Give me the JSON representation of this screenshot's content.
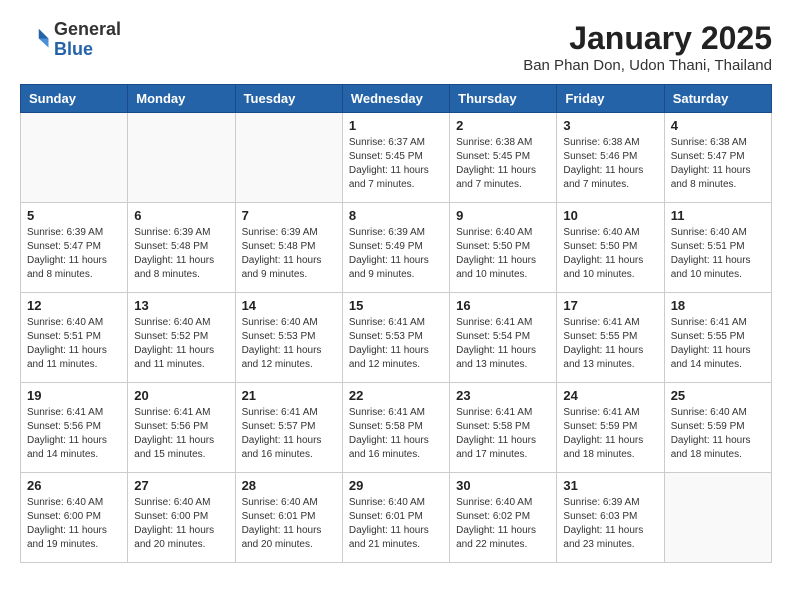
{
  "logo": {
    "general": "General",
    "blue": "Blue"
  },
  "title": "January 2025",
  "subtitle": "Ban Phan Don, Udon Thani, Thailand",
  "weekdays": [
    "Sunday",
    "Monday",
    "Tuesday",
    "Wednesday",
    "Thursday",
    "Friday",
    "Saturday"
  ],
  "weeks": [
    [
      {
        "day": "",
        "sunrise": "",
        "sunset": "",
        "daylight": ""
      },
      {
        "day": "",
        "sunrise": "",
        "sunset": "",
        "daylight": ""
      },
      {
        "day": "",
        "sunrise": "",
        "sunset": "",
        "daylight": ""
      },
      {
        "day": "1",
        "sunrise": "Sunrise: 6:37 AM",
        "sunset": "Sunset: 5:45 PM",
        "daylight": "Daylight: 11 hours and 7 minutes."
      },
      {
        "day": "2",
        "sunrise": "Sunrise: 6:38 AM",
        "sunset": "Sunset: 5:45 PM",
        "daylight": "Daylight: 11 hours and 7 minutes."
      },
      {
        "day": "3",
        "sunrise": "Sunrise: 6:38 AM",
        "sunset": "Sunset: 5:46 PM",
        "daylight": "Daylight: 11 hours and 7 minutes."
      },
      {
        "day": "4",
        "sunrise": "Sunrise: 6:38 AM",
        "sunset": "Sunset: 5:47 PM",
        "daylight": "Daylight: 11 hours and 8 minutes."
      }
    ],
    [
      {
        "day": "5",
        "sunrise": "Sunrise: 6:39 AM",
        "sunset": "Sunset: 5:47 PM",
        "daylight": "Daylight: 11 hours and 8 minutes."
      },
      {
        "day": "6",
        "sunrise": "Sunrise: 6:39 AM",
        "sunset": "Sunset: 5:48 PM",
        "daylight": "Daylight: 11 hours and 8 minutes."
      },
      {
        "day": "7",
        "sunrise": "Sunrise: 6:39 AM",
        "sunset": "Sunset: 5:48 PM",
        "daylight": "Daylight: 11 hours and 9 minutes."
      },
      {
        "day": "8",
        "sunrise": "Sunrise: 6:39 AM",
        "sunset": "Sunset: 5:49 PM",
        "daylight": "Daylight: 11 hours and 9 minutes."
      },
      {
        "day": "9",
        "sunrise": "Sunrise: 6:40 AM",
        "sunset": "Sunset: 5:50 PM",
        "daylight": "Daylight: 11 hours and 10 minutes."
      },
      {
        "day": "10",
        "sunrise": "Sunrise: 6:40 AM",
        "sunset": "Sunset: 5:50 PM",
        "daylight": "Daylight: 11 hours and 10 minutes."
      },
      {
        "day": "11",
        "sunrise": "Sunrise: 6:40 AM",
        "sunset": "Sunset: 5:51 PM",
        "daylight": "Daylight: 11 hours and 10 minutes."
      }
    ],
    [
      {
        "day": "12",
        "sunrise": "Sunrise: 6:40 AM",
        "sunset": "Sunset: 5:51 PM",
        "daylight": "Daylight: 11 hours and 11 minutes."
      },
      {
        "day": "13",
        "sunrise": "Sunrise: 6:40 AM",
        "sunset": "Sunset: 5:52 PM",
        "daylight": "Daylight: 11 hours and 11 minutes."
      },
      {
        "day": "14",
        "sunrise": "Sunrise: 6:40 AM",
        "sunset": "Sunset: 5:53 PM",
        "daylight": "Daylight: 11 hours and 12 minutes."
      },
      {
        "day": "15",
        "sunrise": "Sunrise: 6:41 AM",
        "sunset": "Sunset: 5:53 PM",
        "daylight": "Daylight: 11 hours and 12 minutes."
      },
      {
        "day": "16",
        "sunrise": "Sunrise: 6:41 AM",
        "sunset": "Sunset: 5:54 PM",
        "daylight": "Daylight: 11 hours and 13 minutes."
      },
      {
        "day": "17",
        "sunrise": "Sunrise: 6:41 AM",
        "sunset": "Sunset: 5:55 PM",
        "daylight": "Daylight: 11 hours and 13 minutes."
      },
      {
        "day": "18",
        "sunrise": "Sunrise: 6:41 AM",
        "sunset": "Sunset: 5:55 PM",
        "daylight": "Daylight: 11 hours and 14 minutes."
      }
    ],
    [
      {
        "day": "19",
        "sunrise": "Sunrise: 6:41 AM",
        "sunset": "Sunset: 5:56 PM",
        "daylight": "Daylight: 11 hours and 14 minutes."
      },
      {
        "day": "20",
        "sunrise": "Sunrise: 6:41 AM",
        "sunset": "Sunset: 5:56 PM",
        "daylight": "Daylight: 11 hours and 15 minutes."
      },
      {
        "day": "21",
        "sunrise": "Sunrise: 6:41 AM",
        "sunset": "Sunset: 5:57 PM",
        "daylight": "Daylight: 11 hours and 16 minutes."
      },
      {
        "day": "22",
        "sunrise": "Sunrise: 6:41 AM",
        "sunset": "Sunset: 5:58 PM",
        "daylight": "Daylight: 11 hours and 16 minutes."
      },
      {
        "day": "23",
        "sunrise": "Sunrise: 6:41 AM",
        "sunset": "Sunset: 5:58 PM",
        "daylight": "Daylight: 11 hours and 17 minutes."
      },
      {
        "day": "24",
        "sunrise": "Sunrise: 6:41 AM",
        "sunset": "Sunset: 5:59 PM",
        "daylight": "Daylight: 11 hours and 18 minutes."
      },
      {
        "day": "25",
        "sunrise": "Sunrise: 6:40 AM",
        "sunset": "Sunset: 5:59 PM",
        "daylight": "Daylight: 11 hours and 18 minutes."
      }
    ],
    [
      {
        "day": "26",
        "sunrise": "Sunrise: 6:40 AM",
        "sunset": "Sunset: 6:00 PM",
        "daylight": "Daylight: 11 hours and 19 minutes."
      },
      {
        "day": "27",
        "sunrise": "Sunrise: 6:40 AM",
        "sunset": "Sunset: 6:00 PM",
        "daylight": "Daylight: 11 hours and 20 minutes."
      },
      {
        "day": "28",
        "sunrise": "Sunrise: 6:40 AM",
        "sunset": "Sunset: 6:01 PM",
        "daylight": "Daylight: 11 hours and 20 minutes."
      },
      {
        "day": "29",
        "sunrise": "Sunrise: 6:40 AM",
        "sunset": "Sunset: 6:01 PM",
        "daylight": "Daylight: 11 hours and 21 minutes."
      },
      {
        "day": "30",
        "sunrise": "Sunrise: 6:40 AM",
        "sunset": "Sunset: 6:02 PM",
        "daylight": "Daylight: 11 hours and 22 minutes."
      },
      {
        "day": "31",
        "sunrise": "Sunrise: 6:39 AM",
        "sunset": "Sunset: 6:03 PM",
        "daylight": "Daylight: 11 hours and 23 minutes."
      },
      {
        "day": "",
        "sunrise": "",
        "sunset": "",
        "daylight": ""
      }
    ]
  ]
}
